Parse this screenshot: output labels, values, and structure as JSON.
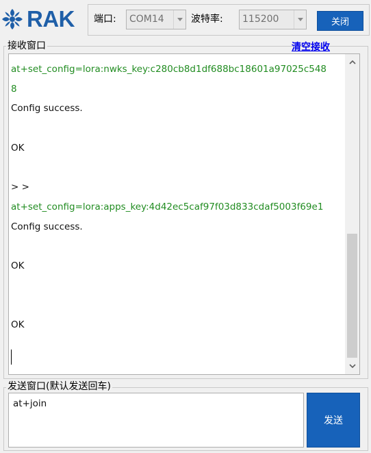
{
  "brand": {
    "logo_text": "RAK",
    "logo_icon": "rak-logo-icon",
    "brand_color": "#1f5fa8"
  },
  "toolbar": {
    "port_label": "端口:",
    "port_value": "COM14",
    "baud_label": "波特率:",
    "baud_value": "115200",
    "close_button": "关闭",
    "button_color": "#1762ba"
  },
  "receive": {
    "title": "接收窗口",
    "clear_link": "清空接收",
    "lines": [
      {
        "text": "at+set_config=lora:nwks_key:c280cb8d1df688bc18601a97025c548",
        "kind": "cmd"
      },
      {
        "text": "8",
        "kind": "cmd"
      },
      {
        "text": "Config success.",
        "kind": "resp"
      },
      {
        "text": "",
        "kind": "resp"
      },
      {
        "text": "OK",
        "kind": "resp"
      },
      {
        "text": "",
        "kind": "resp"
      },
      {
        "text": "> >",
        "kind": "resp"
      },
      {
        "text": "at+set_config=lora:apps_key:4d42ec5caf97f03d833cdaf5003f69e1",
        "kind": "cmd"
      },
      {
        "text": "Config success.",
        "kind": "resp"
      },
      {
        "text": "",
        "kind": "resp"
      },
      {
        "text": "OK",
        "kind": "resp"
      },
      {
        "text": "",
        "kind": "resp"
      },
      {
        "text": "",
        "kind": "resp"
      },
      {
        "text": "OK",
        "kind": "resp"
      }
    ],
    "command_color": "#218c21",
    "scroll_position": 0.78
  },
  "send": {
    "title": "发送窗口(默认发送回车)",
    "input_value": "at+join",
    "send_button": "发送"
  }
}
